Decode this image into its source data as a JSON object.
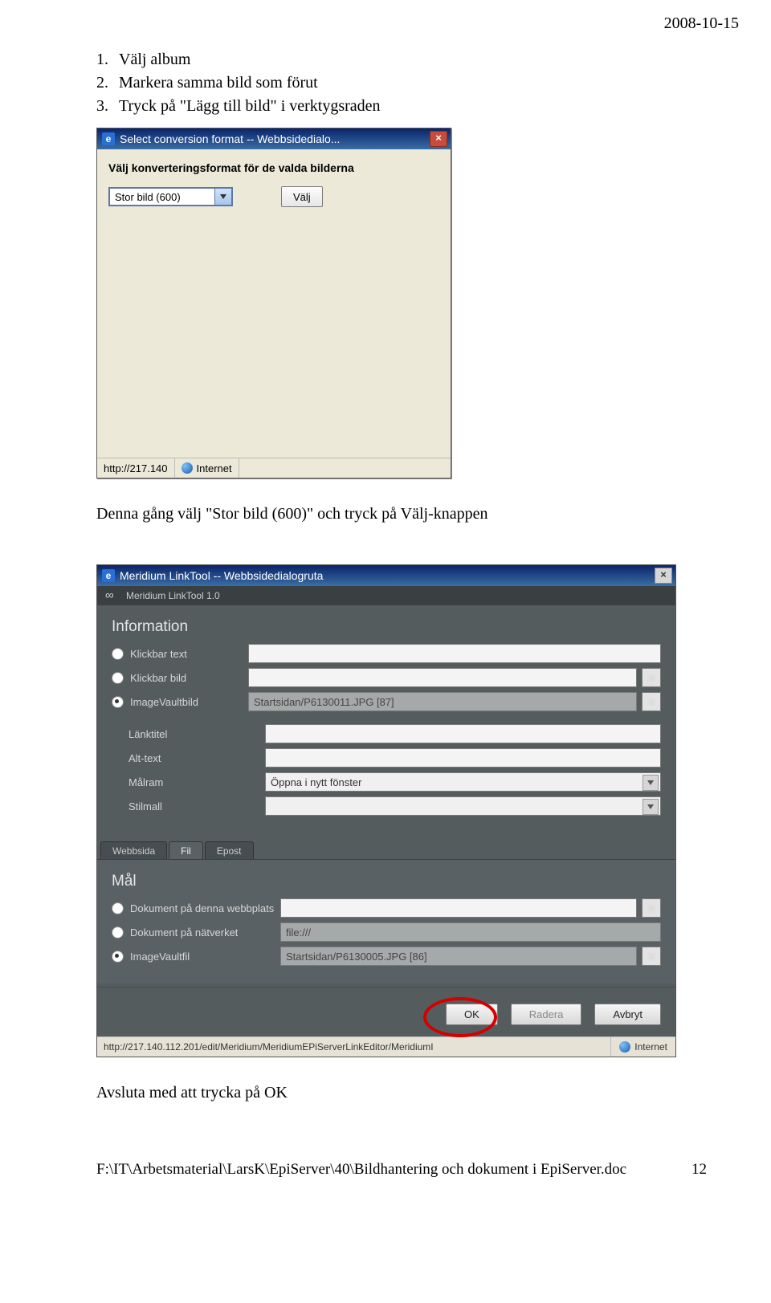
{
  "header": {
    "date": "2008-10-15"
  },
  "instructions": {
    "items": [
      {
        "num": "1.",
        "text": "Välj album"
      },
      {
        "num": "2.",
        "text": "Markera samma bild som förut"
      },
      {
        "num": "3.",
        "text": "Tryck på \"Lägg till bild\" i verktygsraden"
      }
    ]
  },
  "dialog1": {
    "title": "Select conversion format -- Webbsidedialo...",
    "heading": "Välj konverteringsformat för de valda bilderna",
    "combo_value": "Stor bild (600)",
    "valj_btn": "Välj",
    "status_addr": "http://217.140",
    "status_zone": "Internet"
  },
  "midtext": "Denna gång välj \"Stor bild (600)\" och tryck på Välj-knappen",
  "dialog2": {
    "title": "Meridium LinkTool -- Webbsidedialogruta",
    "toolbar": "Meridium LinkTool 1.0",
    "info_title": "Information",
    "rows": {
      "klickbar_text": "Klickbar text",
      "klickbar_bild": "Klickbar bild",
      "imagevaultbild": "ImageVaultbild",
      "imagevault_value": "Startsidan/P6130011.JPG [87]",
      "lanktitel": "Länktitel",
      "alttext": "Alt-text",
      "malram": "Målram",
      "malram_value": "Öppna i nytt fönster",
      "stilmall": "Stilmall"
    },
    "tabs": {
      "webbsida": "Webbsida",
      "fil": "Fil",
      "epost": "Epost"
    },
    "mal_title": "Mål",
    "mal": {
      "dok_webbplats": "Dokument på denna webbplats",
      "dok_natverk": "Dokument på nätverket",
      "dok_natverk_value": "file:///",
      "imagevaultfil": "ImageVaultfil",
      "imagevault_value": "Startsidan/P6130005.JPG [86]"
    },
    "buttons": {
      "ok": "OK",
      "radera": "Radera",
      "avbryt": "Avbryt"
    },
    "status_addr": "http://217.140.112.201/edit/Meridium/MeridiumEPiServerLinkEditor/MeridiumI",
    "status_zone": "Internet"
  },
  "closing": "Avsluta med att trycka på OK",
  "footer": {
    "path": "F:\\IT\\Arbetsmaterial\\LarsK\\EpiServer\\40\\Bildhantering och dokument i EpiServer.doc",
    "page": "12"
  }
}
